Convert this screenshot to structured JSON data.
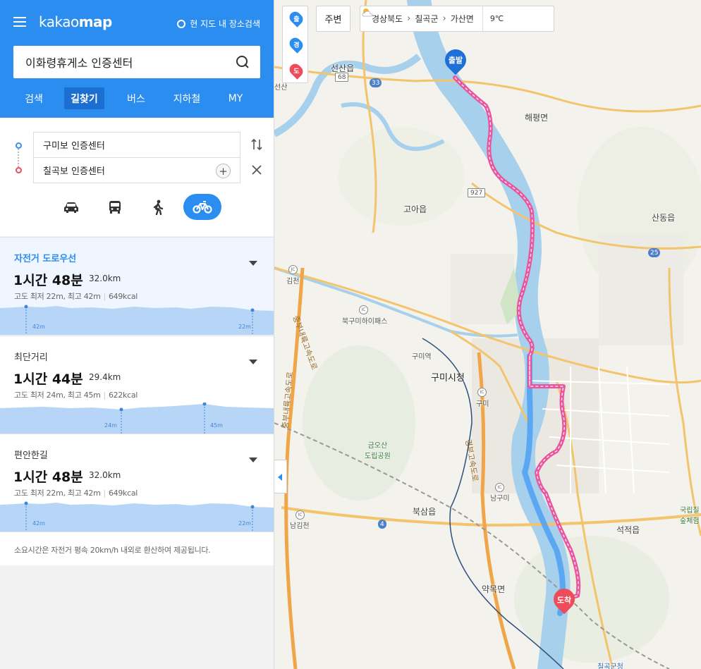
{
  "app": {
    "logo_light": "kakao",
    "logo_bold": "map",
    "nearby_search": "현 지도 내 장소검색"
  },
  "search": {
    "value": "이화령휴게소 인증센터"
  },
  "tabs": [
    "검색",
    "길찾기",
    "버스",
    "지하철",
    "MY"
  ],
  "route": {
    "origin": "구미보 인증센터",
    "destination": "칠곡보 인증센터"
  },
  "modes": [
    "car",
    "transit",
    "walk",
    "bicycle"
  ],
  "results": [
    {
      "title": "자전거 도로우선",
      "hours": "1",
      "hours_unit": "시간",
      "minutes": "48",
      "minutes_unit": "분",
      "distance": "32.0km",
      "meta_elev": "고도 최저 22m, 최고 42m",
      "meta_kcal": "649kcal",
      "profile_low": "42m",
      "profile_high": "22m"
    },
    {
      "title": "최단거리",
      "hours": "1",
      "hours_unit": "시간",
      "minutes": "44",
      "minutes_unit": "분",
      "distance": "29.4km",
      "meta_elev": "고도 최저 24m, 최고 45m",
      "meta_kcal": "622kcal",
      "profile_low": "24m",
      "profile_high": "45m"
    },
    {
      "title": "편안한길",
      "hours": "1",
      "hours_unit": "시간",
      "minutes": "48",
      "minutes_unit": "분",
      "distance": "32.0km",
      "meta_elev": "고도 최저 22m, 최고 42m",
      "meta_kcal": "649kcal",
      "profile_low": "42m",
      "profile_high": "22m"
    }
  ],
  "note": "소요시간은 자전거 평속 20km/h 내외로 환산하여 제공됩니다.",
  "map": {
    "pins_bar": [
      "출",
      "경",
      "도"
    ],
    "nearby_button": "주변",
    "breadcrumb": [
      "경상북도",
      "칠곡군",
      "가산면"
    ],
    "weather_temp": "9℃",
    "start_label": "출발",
    "end_label": "도착",
    "labels": {
      "seonsan": "선산읍",
      "haepyeong": "해평면",
      "goa": "고아읍",
      "sandong": "산동읍",
      "gimcheon": "김천",
      "bukgumi": "북구미하이패스",
      "gumi_station": "구미역",
      "gumi_cityhall": "구미시청",
      "gumi_ic": "구미",
      "geumosan": "금오산\n도립공원",
      "namgumi": "남구미",
      "buksam": "북삼읍",
      "seokjeok": "석적읍",
      "yakmok": "약목면",
      "namgimcheon": "남김천",
      "chilgok_hall": "칠곡군청",
      "national_forest": "국립칠\n숲체험",
      "seonsan_small": "선산",
      "expressway_1": "중부내륙고속도로",
      "expressway_2": "경부고속도로",
      "expressway_3": "중부내륙고속도로"
    },
    "shields": {
      "r68": "68",
      "r33": "33",
      "r927": "927",
      "r25": "25",
      "r4": "4"
    },
    "ic": "IC",
    "jc": "JC"
  },
  "colors": {
    "accent": "#2b8df0",
    "route_pink": "#e9559e",
    "route_blue": "#4a9cf2",
    "river": "#a6d0ec",
    "end_pin": "#ee4c5a"
  }
}
